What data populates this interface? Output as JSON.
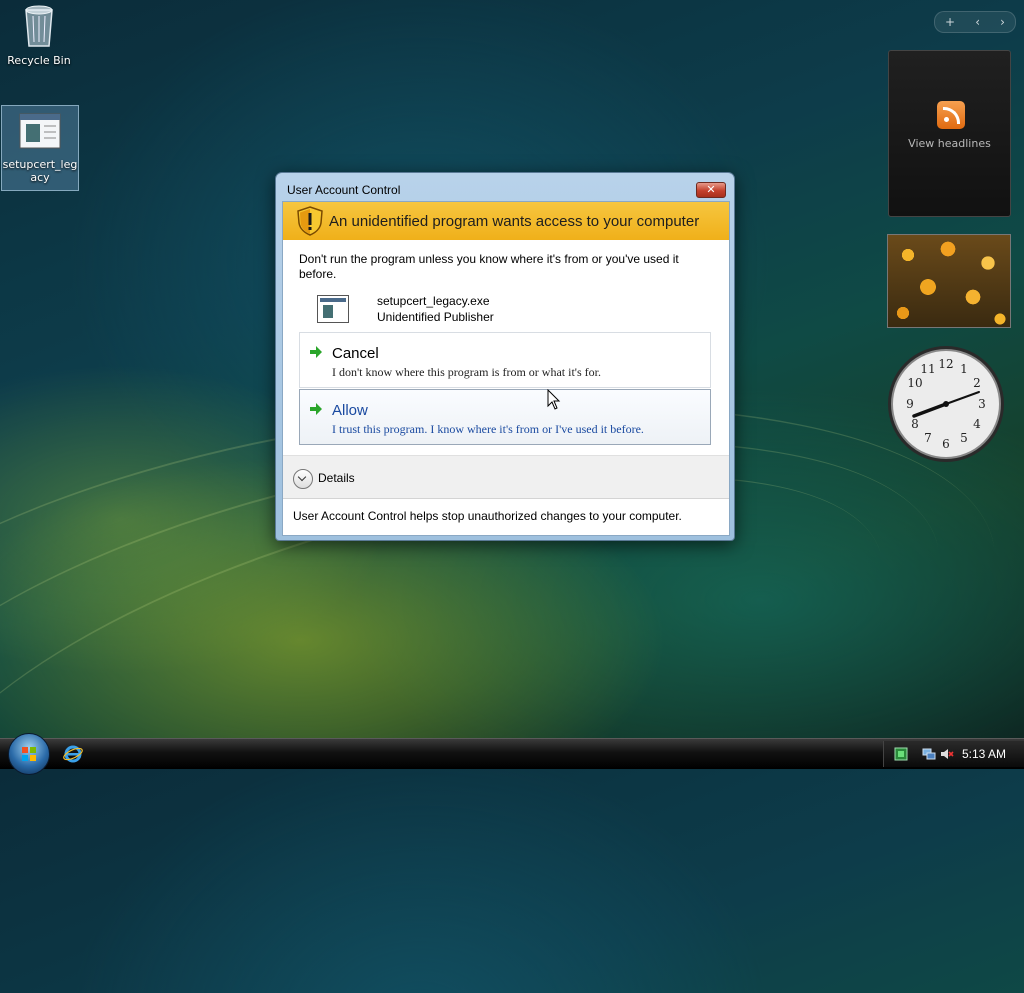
{
  "desktop": {
    "icons": [
      {
        "label": "Recycle Bin"
      },
      {
        "label": "setupcert_leg acy"
      }
    ]
  },
  "sidebar": {
    "feed_label": "View headlines",
    "clock_time": "8:13"
  },
  "dialog": {
    "title": "User Account Control",
    "close_symbol": "✕",
    "banner": "An unidentified program wants access to your computer",
    "intro": "Don't run the program unless you know where it's from or you've used it before.",
    "program_name": "setupcert_legacy.exe",
    "publisher": "Unidentified Publisher",
    "options": [
      {
        "title": "Cancel",
        "desc": "I don't know where this program is from or what it's for."
      },
      {
        "title": "Allow",
        "desc": "I trust this program. I know where it's from or I've used it before."
      }
    ],
    "details_label": "Details",
    "footer": "User Account Control helps stop unauthorized changes to your computer."
  },
  "taskbar": {
    "clock": "5:13 AM"
  },
  "colors": {
    "banner": "#f0b01a",
    "allow_text": "#1a4aa0",
    "arrow_green": "#2aa52a"
  }
}
